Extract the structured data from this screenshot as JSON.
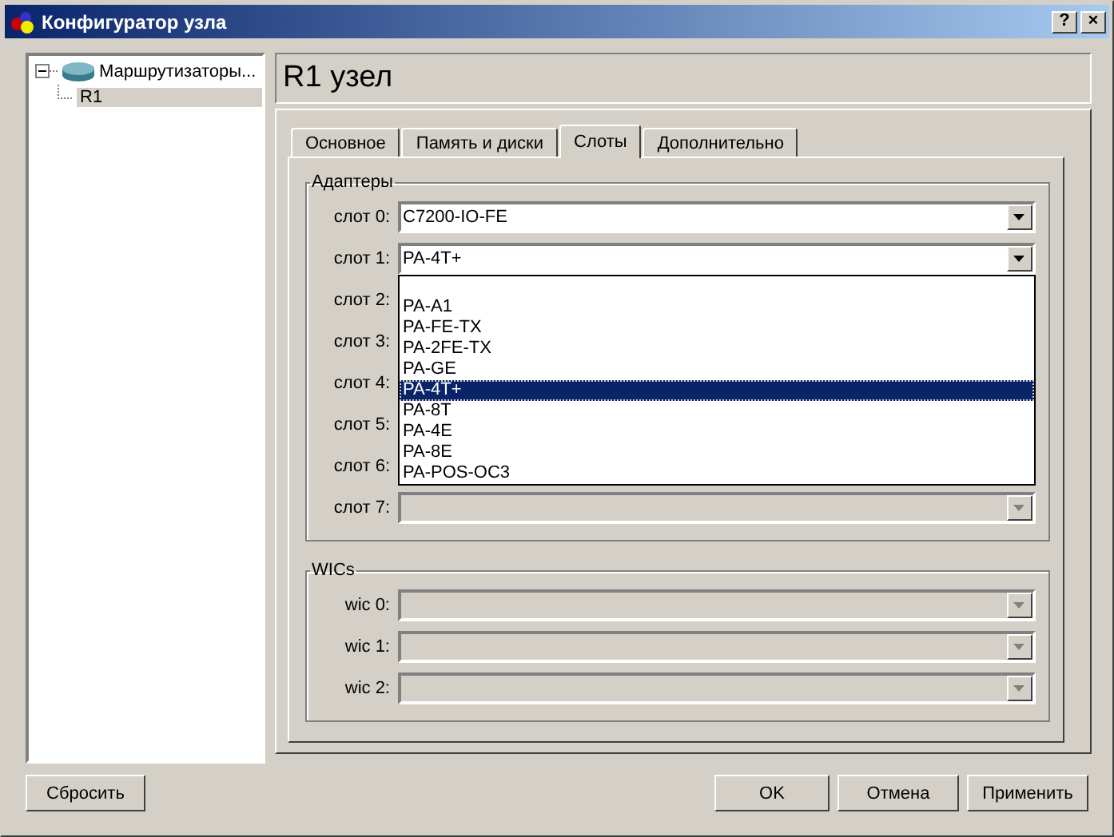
{
  "window": {
    "title": "Конфигуратор узла",
    "buttons": [
      "?",
      "×"
    ]
  },
  "tree": [
    {
      "label": "Маршрутизаторы...",
      "expanded": true,
      "selected": false,
      "children": [
        {
          "label": "R1",
          "selected": true
        }
      ]
    }
  ],
  "header": "R1 узел",
  "tabs": [
    {
      "label": "Основное",
      "selected": false
    },
    {
      "label": "Память и диски",
      "selected": false
    },
    {
      "label": "Слоты",
      "selected": true
    },
    {
      "label": "Дополнительно",
      "selected": false
    }
  ],
  "adapters": {
    "title": "Адаптеры",
    "slots": [
      {
        "label": "слот 0:",
        "kind": "combo",
        "value": "C7200-IO-FE",
        "disabled": false
      },
      {
        "label": "слот 1:",
        "kind": "combo",
        "value": "PA-4T+",
        "disabled": false
      },
      {
        "label": "слот 2:",
        "kind": "covered"
      },
      {
        "label": "слот 3:",
        "kind": "covered"
      },
      {
        "label": "слот 4:",
        "kind": "covered"
      },
      {
        "label": "слот 5:",
        "kind": "covered"
      },
      {
        "label": "слот 6:",
        "kind": "covered"
      },
      {
        "label": "слот 7:",
        "kind": "combo",
        "disabled": true
      }
    ],
    "dropdown": [
      {
        "label": "PA-A1",
        "selected": false
      },
      {
        "label": "PA-FE-TX",
        "selected": false
      },
      {
        "label": "PA-2FE-TX",
        "selected": false
      },
      {
        "label": "PA-GE",
        "selected": false
      },
      {
        "label": "PA-4T+",
        "selected": true
      },
      {
        "label": "PA-8T",
        "selected": false
      },
      {
        "label": "PA-4E",
        "selected": false
      },
      {
        "label": "PA-8E",
        "selected": false
      },
      {
        "label": "PA-POS-OC3",
        "selected": false
      }
    ]
  },
  "wics": {
    "title": "WICs",
    "slots": [
      {
        "label": "wic 0:",
        "kind": "combo",
        "disabled": true
      },
      {
        "label": "wic 1:",
        "kind": "combo",
        "disabled": true
      },
      {
        "label": "wic 2:",
        "kind": "combo",
        "disabled": true
      }
    ]
  },
  "buttons": {
    "reset": "Сбросить",
    "actions": [
      "OK",
      "Отмена",
      "Применить"
    ]
  }
}
